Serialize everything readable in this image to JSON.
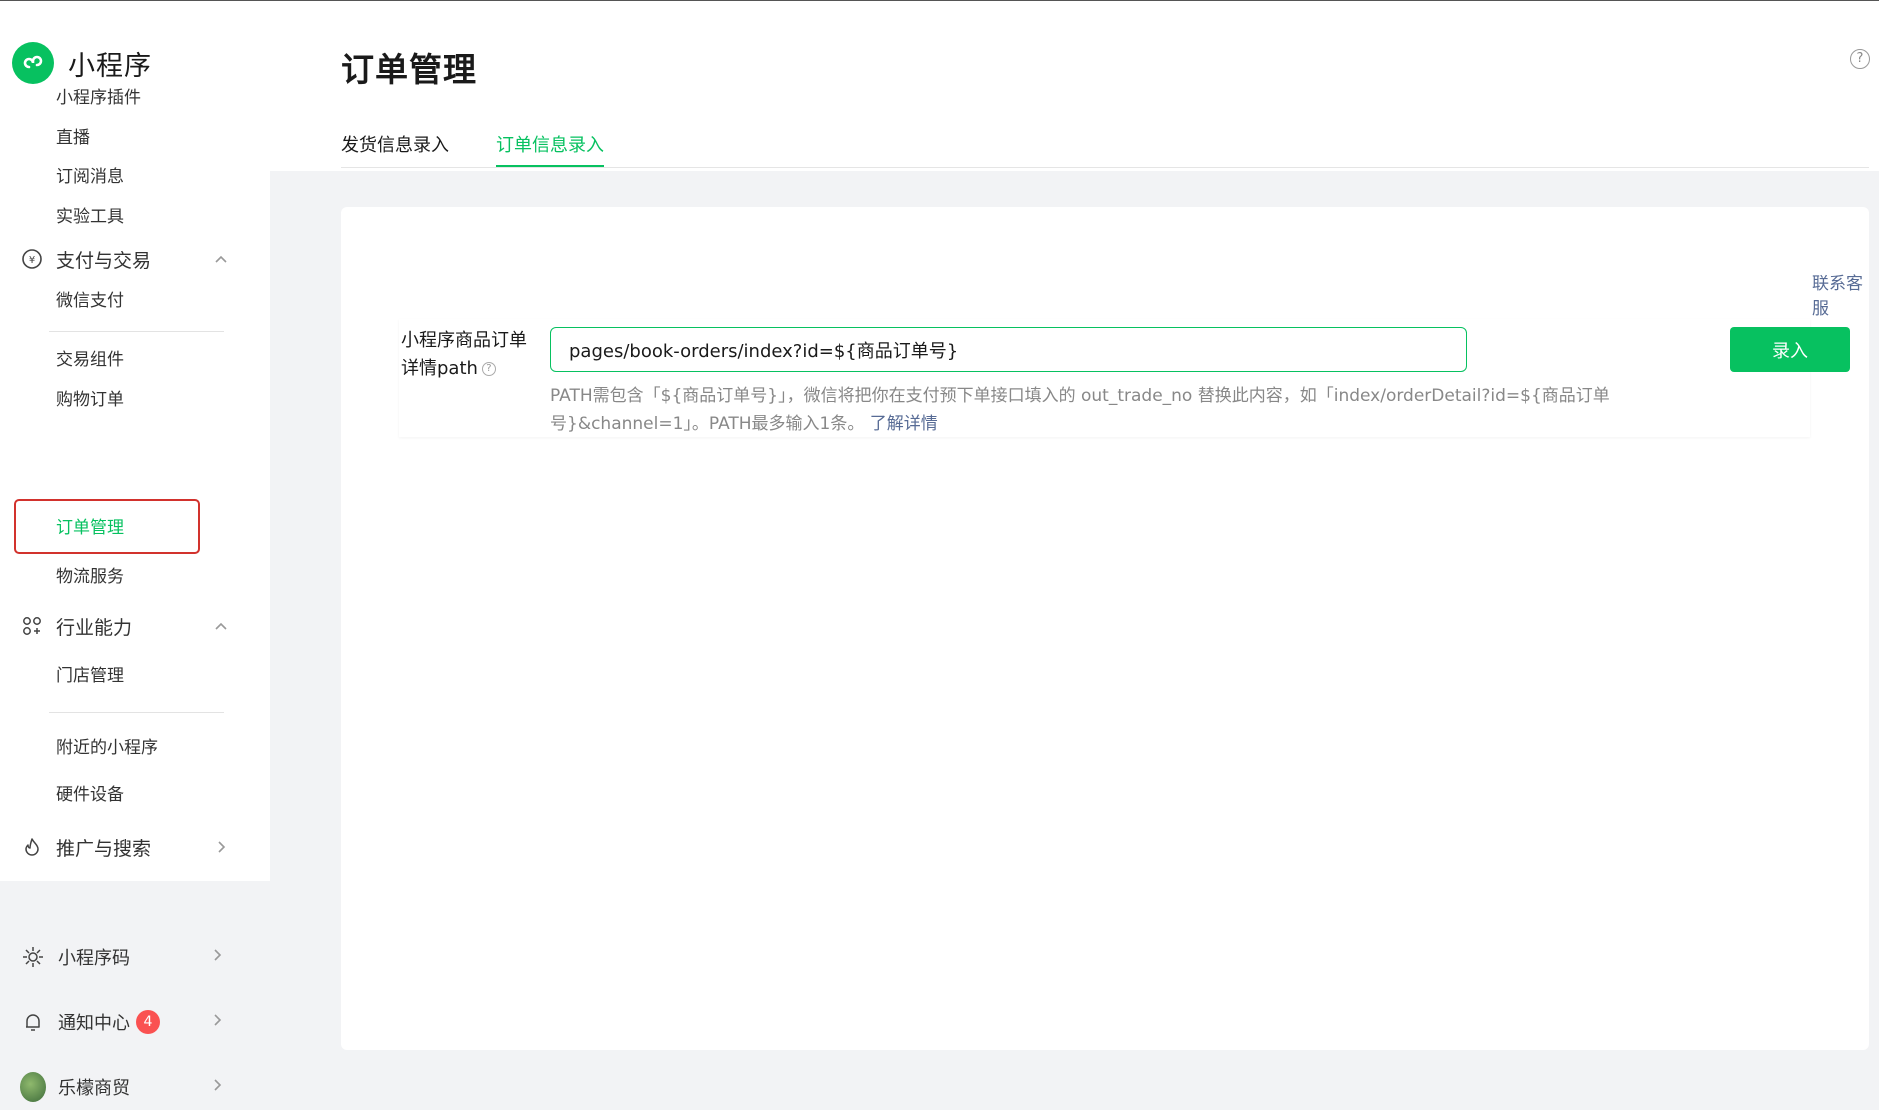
{
  "app": {
    "brand": "小程序"
  },
  "sidebar": {
    "items_top": [
      {
        "label": "小程序插件"
      },
      {
        "label": "直播"
      },
      {
        "label": "订阅消息"
      },
      {
        "label": "实验工具"
      }
    ],
    "group_payment": {
      "label": "支付与交易",
      "icon": "yuan-circle-icon",
      "state": "expanded"
    },
    "payment_items": [
      {
        "label": "微信支付"
      },
      {
        "label": "交易组件"
      },
      {
        "label": "购物订单"
      },
      {
        "label": "订单管理",
        "active": true
      },
      {
        "label": "物流服务"
      }
    ],
    "group_industry": {
      "label": "行业能力",
      "icon": "industry-icon",
      "state": "expanded"
    },
    "industry_items": [
      {
        "label": "门店管理"
      },
      {
        "label": "附近的小程序"
      },
      {
        "label": "硬件设备"
      }
    ],
    "group_promo": {
      "label": "推广与搜索",
      "icon": "fire-icon",
      "state": "collapsed"
    },
    "bottom": [
      {
        "label": "小程序码",
        "icon": "sun-icon"
      },
      {
        "label": "通知中心",
        "icon": "bell-icon",
        "badge": "4"
      },
      {
        "label": "乐檬商贸",
        "icon": "avatar"
      }
    ],
    "active_color": "#07c160",
    "highlight_color": "#d2322d"
  },
  "main": {
    "title": "订单管理",
    "help": "?",
    "tabs": [
      {
        "label": "发货信息录入",
        "active": false
      },
      {
        "label": "订单信息录入",
        "active": true
      }
    ],
    "card": {
      "contact_link": "联系客服",
      "field_label_line1": "小程序商品订单",
      "field_label_line2": "详情path",
      "field_help": "?",
      "input_value": "pages/book-orders/index?id=${商品订单号}",
      "submit_label": "录入",
      "hint_line1": "PATH需包含「${商品订单号}」，微信将把你在支付预下单接口填入的 out_trade_no 替换此内容，如「index/orderDetail?id=${商品订单",
      "hint_line2": "号}&channel=1」。PATH最多输入1条。",
      "hint_link": "了解详情"
    },
    "accent_color": "#07c160",
    "link_color": "#576b95"
  }
}
